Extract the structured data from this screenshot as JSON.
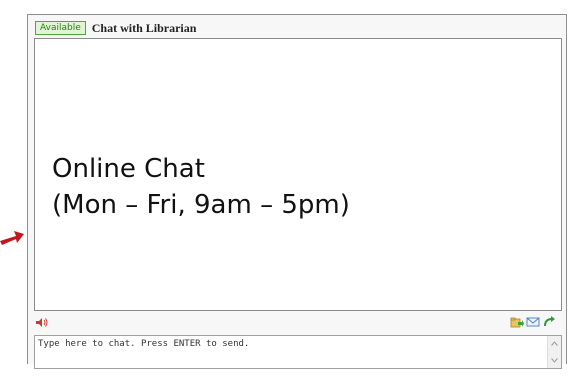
{
  "header": {
    "status": "Available",
    "title": "Chat with Librarian"
  },
  "chat": {
    "line1": "Online Chat",
    "line2": "(Mon – Fri, 9am – 5pm)"
  },
  "input": {
    "placeholder": "Type here to chat. Press ENTER to send."
  },
  "icons": {
    "sound": "speaker-icon",
    "tools": [
      "file-transfer-icon",
      "email-icon",
      "refresh-icon"
    ],
    "pointer": "red-arrow-icon"
  },
  "colors": {
    "status_green": "#52a73c",
    "arrow_red": "#c4161c"
  }
}
